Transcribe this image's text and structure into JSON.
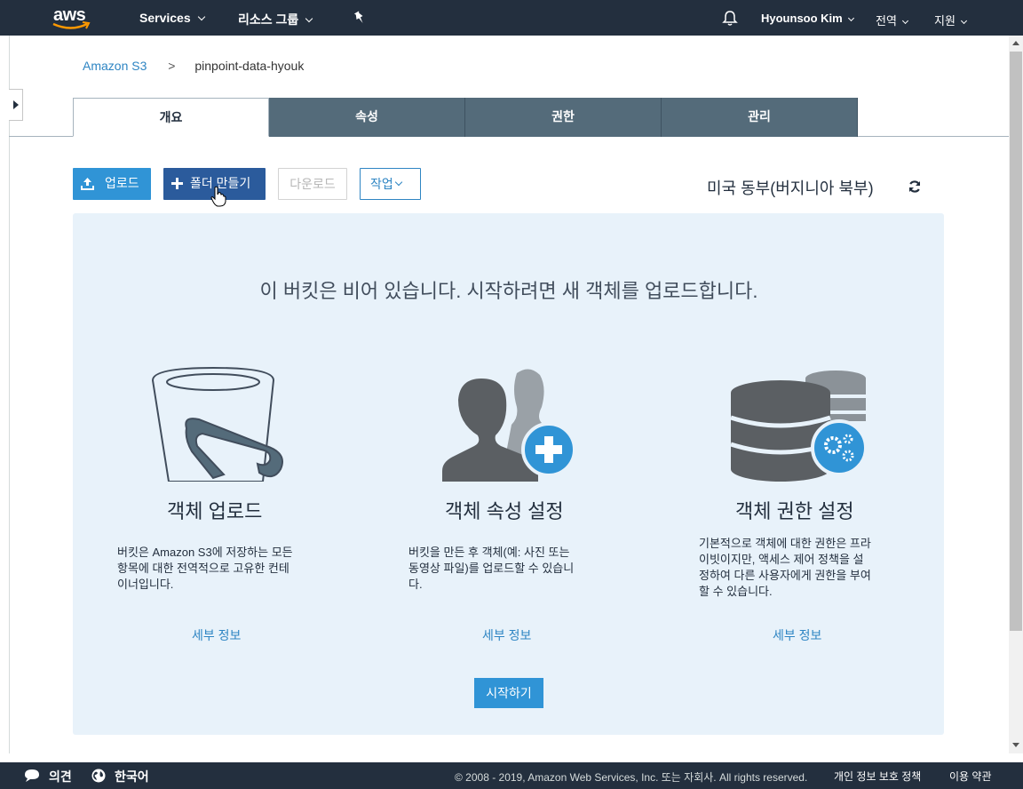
{
  "topbar": {
    "logo_text": "aws",
    "services": "Services",
    "resource_groups": "리소스 그룹",
    "user": "Hyounsoo Kim",
    "region": "전역",
    "support": "지원"
  },
  "breadcrumb": {
    "root": "Amazon S3",
    "separator": ">",
    "bucket": "pinpoint-data-hyouk"
  },
  "tabs": [
    {
      "label": "개요"
    },
    {
      "label": "속성"
    },
    {
      "label": "권한"
    },
    {
      "label": "관리"
    }
  ],
  "toolbar": {
    "upload": "업로드",
    "create_folder": "폴더 만들기",
    "download": "다운로드",
    "actions": "작업"
  },
  "region_label": "미국 동부(버지니아 북부)",
  "panel": {
    "title": "이 버킷은 비어 있습니다. 시작하려면 새 객체를 업로드합니다.",
    "columns": [
      {
        "icon": "bucket-icon",
        "title": "객체 업로드",
        "lines": [
          "버킷은 Amazon S3에 저장하는 모든",
          "항목에 대한 전역적으로 고유한 컨테",
          "이너입니다."
        ],
        "link": "세부 정보"
      },
      {
        "icon": "add-user-icon",
        "title": "객체 속성 설정",
        "lines": [
          "버킷을 만든 후 객체(예: 사진 또는",
          "동영상 파일)를 업로드할 수 있습니",
          "다."
        ],
        "link": "세부 정보"
      },
      {
        "icon": "database-gear-icon",
        "title": "객체 권한 설정",
        "lines": [
          "기본적으로 객체에 대한 권한은 프라",
          "이빗이지만, 액세스 제어 정책을 설",
          "정하여 다른 사용자에게 권한을 부여",
          "할 수 있습니다."
        ],
        "link": "세부 정보"
      }
    ],
    "start_button": "시작하기"
  },
  "footer": {
    "feedback": "의견",
    "language": "한국어",
    "copyright": "© 2008 - 2019, Amazon Web Services, Inc. 또는 자회사. All rights reserved.",
    "privacy": "개인 정보 보호 정책",
    "terms": "이용 약관"
  },
  "colors": {
    "nav_bg": "#232f3e",
    "tab_bg": "#546b7a",
    "primary_blue": "#3094d6",
    "folder_btn": "#2b5b9c",
    "panel_bg": "#e8f2fa",
    "link": "#2e85c3"
  }
}
